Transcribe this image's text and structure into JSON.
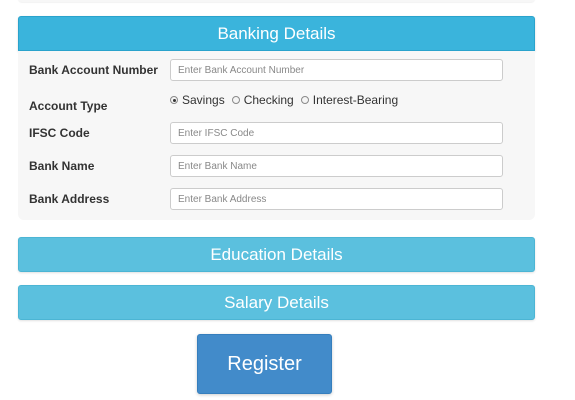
{
  "banking": {
    "title": "Banking Details",
    "fields": {
      "account_number": {
        "label": "Bank Account Number",
        "placeholder": "Enter Bank Account Number"
      },
      "account_type": {
        "label": "Account Type",
        "options": [
          "Savings",
          "Checking",
          "Interest-Bearing"
        ],
        "selected": "Savings"
      },
      "ifsc": {
        "label": "IFSC Code",
        "placeholder": "Enter IFSC Code"
      },
      "bank_name": {
        "label": "Bank Name",
        "placeholder": "Enter Bank Name"
      },
      "bank_address": {
        "label": "Bank Address",
        "placeholder": "Enter Bank Address"
      }
    }
  },
  "education": {
    "title": "Education Details"
  },
  "salary": {
    "title": "Salary Details"
  },
  "actions": {
    "register_label": "Register"
  },
  "colors": {
    "banking_header": "#3ab4dc",
    "collapsed_header": "#5bc0de",
    "register_button": "#428bca",
    "panel_body": "#f7f7f7"
  }
}
